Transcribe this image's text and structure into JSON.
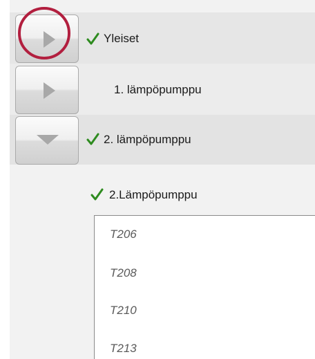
{
  "tree": {
    "items": [
      {
        "label": "Yleiset",
        "checked": true,
        "expanded": false
      },
      {
        "label": "1. lämpöpumppu",
        "checked": false,
        "expanded": false
      },
      {
        "label": "2. lämpöpumppu",
        "checked": true,
        "expanded": true
      }
    ]
  },
  "subsection": {
    "label": "2.Lämpöpumppu",
    "checked": true,
    "list": [
      "T206",
      "T208",
      "T210",
      "T213"
    ]
  },
  "colors": {
    "check": "#2e8b1f",
    "highlight_ring": "#b21f3f",
    "arrow": "#a8a8a8"
  },
  "icons": {
    "collapsed": "chevron-right-icon",
    "expanded": "chevron-down-icon",
    "checked": "check-icon"
  }
}
